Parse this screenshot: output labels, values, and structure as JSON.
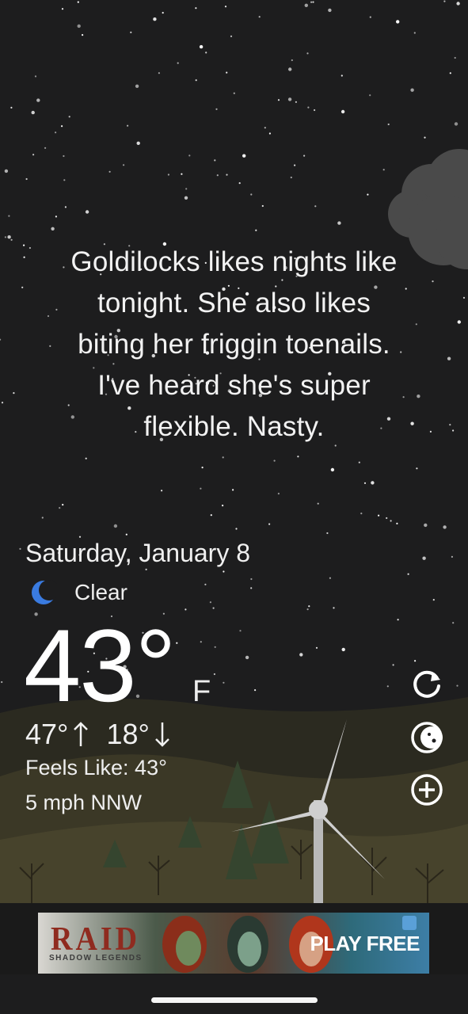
{
  "quote": {
    "lines": [
      "Goldilocks likes nights like",
      "tonight. She also likes",
      "biting her friggin toenails.",
      "I've heard she's super",
      "flexible. Nasty."
    ]
  },
  "weather": {
    "date": "Saturday, January 8",
    "condition": "Clear",
    "condition_icon": "moon-icon",
    "temperature": "43°",
    "unit": "F",
    "high": "47°",
    "low": "18°",
    "feels_like": "Feels Like: 43°",
    "wind": "5 mph NNW"
  },
  "actions": {
    "refresh_icon": "refresh-icon",
    "moon_phase_icon": "moon-phase-icon",
    "add_icon": "add-location-icon"
  },
  "ad": {
    "brand": "RAID",
    "tagline": "SHADOW LEGENDS",
    "cta": "PLAY FREE"
  },
  "colors": {
    "sky": "#1d1d1e",
    "moon_accent": "#3a7be0",
    "hills": "#3e3a26",
    "trees": "#3d4d33"
  }
}
